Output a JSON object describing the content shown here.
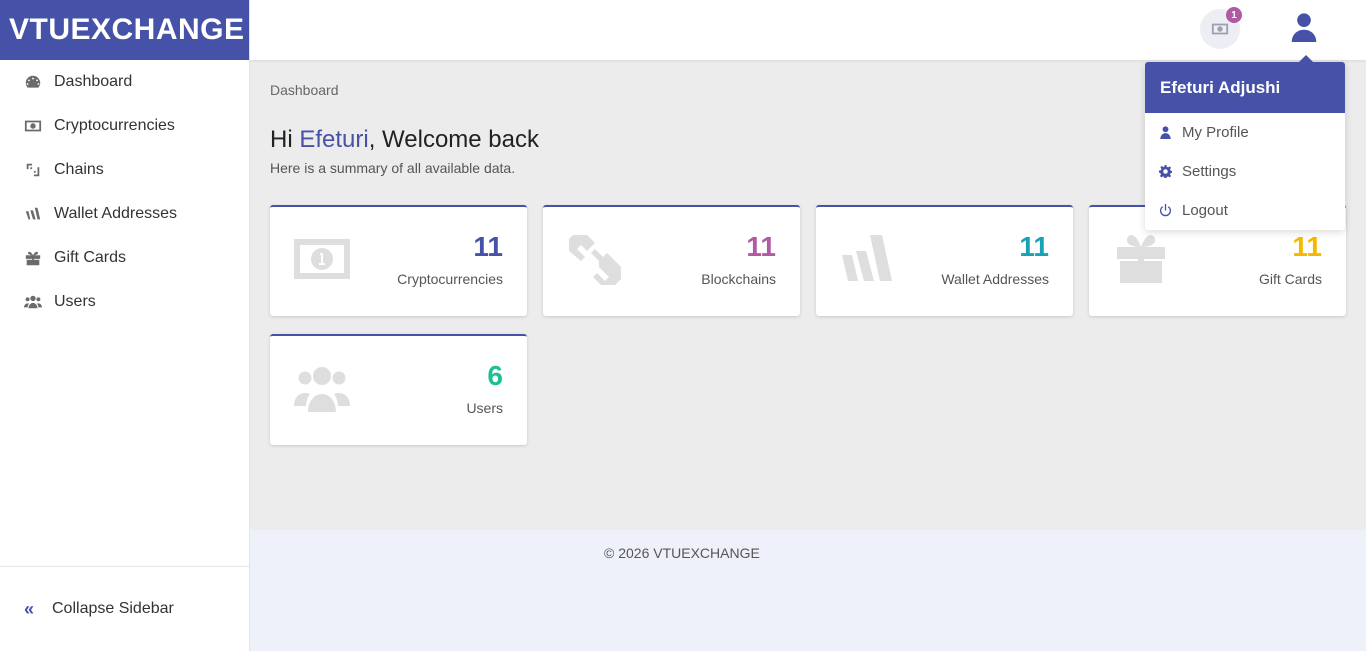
{
  "brand": "VTUEXCHANGE",
  "sidebar": {
    "items": [
      {
        "label": "Dashboard",
        "icon": "dashboard-icon"
      },
      {
        "label": "Cryptocurrencies",
        "icon": "money-bill-icon"
      },
      {
        "label": "Chains",
        "icon": "link-icon"
      },
      {
        "label": "Wallet Addresses",
        "icon": "wallet-icon"
      },
      {
        "label": "Gift Cards",
        "icon": "gift-icon"
      },
      {
        "label": "Users",
        "icon": "users-icon"
      }
    ],
    "collapse_label": "Collapse Sidebar",
    "collapse_icon": "«"
  },
  "header": {
    "notification_count": "1"
  },
  "main": {
    "breadcrumb": "Dashboard",
    "greeting_prefix": "Hi ",
    "user_first_name": "Efeturi",
    "greeting_suffix": ", Welcome back",
    "subtitle": "Here is a summary of all available data.",
    "cards": [
      {
        "value": "11",
        "label": "Cryptocurrencies",
        "color": "#4651a8",
        "icon": "money-bill-icon"
      },
      {
        "value": "11",
        "label": "Blockchains",
        "color": "#b05aa3",
        "icon": "link-icon"
      },
      {
        "value": "11",
        "label": "Wallet Addresses",
        "color": "#17a2b8",
        "icon": "wallet-icon"
      },
      {
        "value": "11",
        "label": "Gift Cards",
        "color": "#f5b800",
        "icon": "gift-icon"
      },
      {
        "value": "6",
        "label": "Users",
        "color": "#1fbf8f",
        "icon": "users-icon"
      }
    ]
  },
  "dropdown": {
    "user_name": "Efeturi Adjushi",
    "items": [
      {
        "label": "My Profile",
        "icon": "user-icon"
      },
      {
        "label": "Settings",
        "icon": "gear-icon"
      },
      {
        "label": "Logout",
        "icon": "power-icon"
      }
    ]
  },
  "footer": {
    "copyright": "© 2026 VTUEXCHANGE"
  },
  "colors": {
    "primary": "#4651a8",
    "background": "#ececec",
    "footer_bg": "#eef1f9"
  }
}
